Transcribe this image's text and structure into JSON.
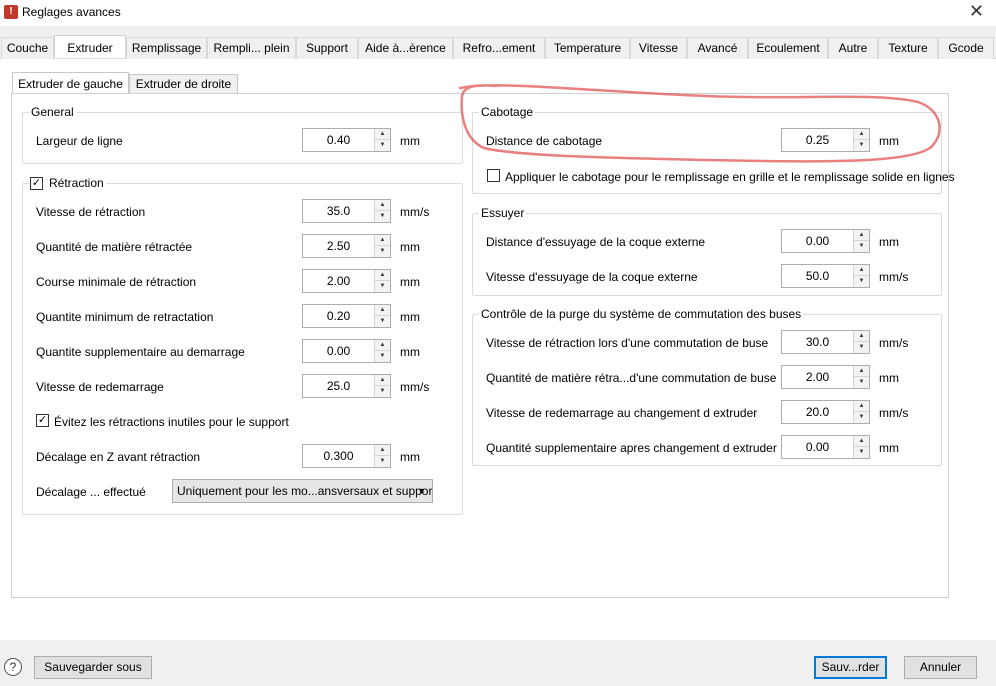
{
  "window": {
    "title": "Reglages avances",
    "close_label": "✕",
    "app_icon_glyph": "!"
  },
  "tabs": [
    {
      "label": "Couche"
    },
    {
      "label": "Extruder"
    },
    {
      "label": "Remplissage"
    },
    {
      "label": "Rempli... plein"
    },
    {
      "label": "Support"
    },
    {
      "label": "Aide à...èrence"
    },
    {
      "label": "Refro...ement"
    },
    {
      "label": "Temperature"
    },
    {
      "label": "Vitesse"
    },
    {
      "label": "Avancé"
    },
    {
      "label": "Ecoulement"
    },
    {
      "label": "Autre"
    },
    {
      "label": "Texture"
    },
    {
      "label": "Gcode"
    }
  ],
  "active_tab": "Extruder",
  "subtabs": [
    {
      "label": "Extruder de gauche"
    },
    {
      "label": "Extruder de droite"
    }
  ],
  "general": {
    "title": "General",
    "line_width": {
      "label": "Largeur de ligne",
      "value": "0.40",
      "unit": "mm"
    }
  },
  "retraction": {
    "title": "Rétraction",
    "checked": true,
    "rows": [
      {
        "label": "Vitesse de rétraction",
        "value": "35.0",
        "unit": "mm/s"
      },
      {
        "label": "Quantité de matière rétractée",
        "value": "2.50",
        "unit": "mm"
      },
      {
        "label": "Course minimale de rétraction",
        "value": "2.00",
        "unit": "mm"
      },
      {
        "label": "Quantite minimum de retractation",
        "value": "0.20",
        "unit": "mm"
      },
      {
        "label": "Quantite supplementaire au demarrage",
        "value": "0.00",
        "unit": "mm"
      },
      {
        "label": "Vitesse de redemarrage",
        "value": "25.0",
        "unit": "mm/s"
      }
    ],
    "avoid_support": {
      "label": "Évitez les rétractions inutiles pour le support",
      "checked": true
    },
    "z_hop": {
      "label": "Décalage en Z avant rétraction",
      "value": "0.300",
      "unit": "mm"
    },
    "hop_mode": {
      "label": "Décalage ... effectué",
      "value": "Uniquement pour les mo...ansversaux et supports"
    }
  },
  "coasting": {
    "title": "Cabotage",
    "distance": {
      "label": "Distance de cabotage",
      "value": "0.25",
      "unit": "mm"
    },
    "apply": {
      "label": "Appliquer le cabotage pour le remplissage en grille et le remplissage solide en lignes",
      "checked": false
    }
  },
  "wipe": {
    "title": "Essuyer",
    "rows": [
      {
        "label": "Distance d'essuyage de la coque externe",
        "value": "0.00",
        "unit": "mm"
      },
      {
        "label": "Vitesse d'essuyage de la coque externe",
        "value": "50.0",
        "unit": "mm/s"
      }
    ]
  },
  "purge": {
    "title": "Contrôle de la purge du système de commutation des buses",
    "rows": [
      {
        "label": "Vitesse de rétraction lors d'une commutation de buse",
        "value": "30.0",
        "unit": "mm/s"
      },
      {
        "label": "Quantité de matière rétra...d'une commutation de buse",
        "value": "2.00",
        "unit": "mm"
      },
      {
        "label": "Vitesse de redemarrage au changement d extruder",
        "value": "20.0",
        "unit": "mm/s"
      },
      {
        "label": "Quantité supplementaire apres changement d extruder",
        "value": "0.00",
        "unit": "mm"
      }
    ]
  },
  "footer": {
    "help_glyph": "?",
    "save_as": "Sauvegarder sous",
    "save": "Sauv...rder",
    "cancel": "Annuler"
  },
  "glyphs": {
    "up": "▲",
    "down": "▼",
    "check": "✓",
    "combo_arrow": "▼"
  },
  "annotation_color": "#e05555"
}
